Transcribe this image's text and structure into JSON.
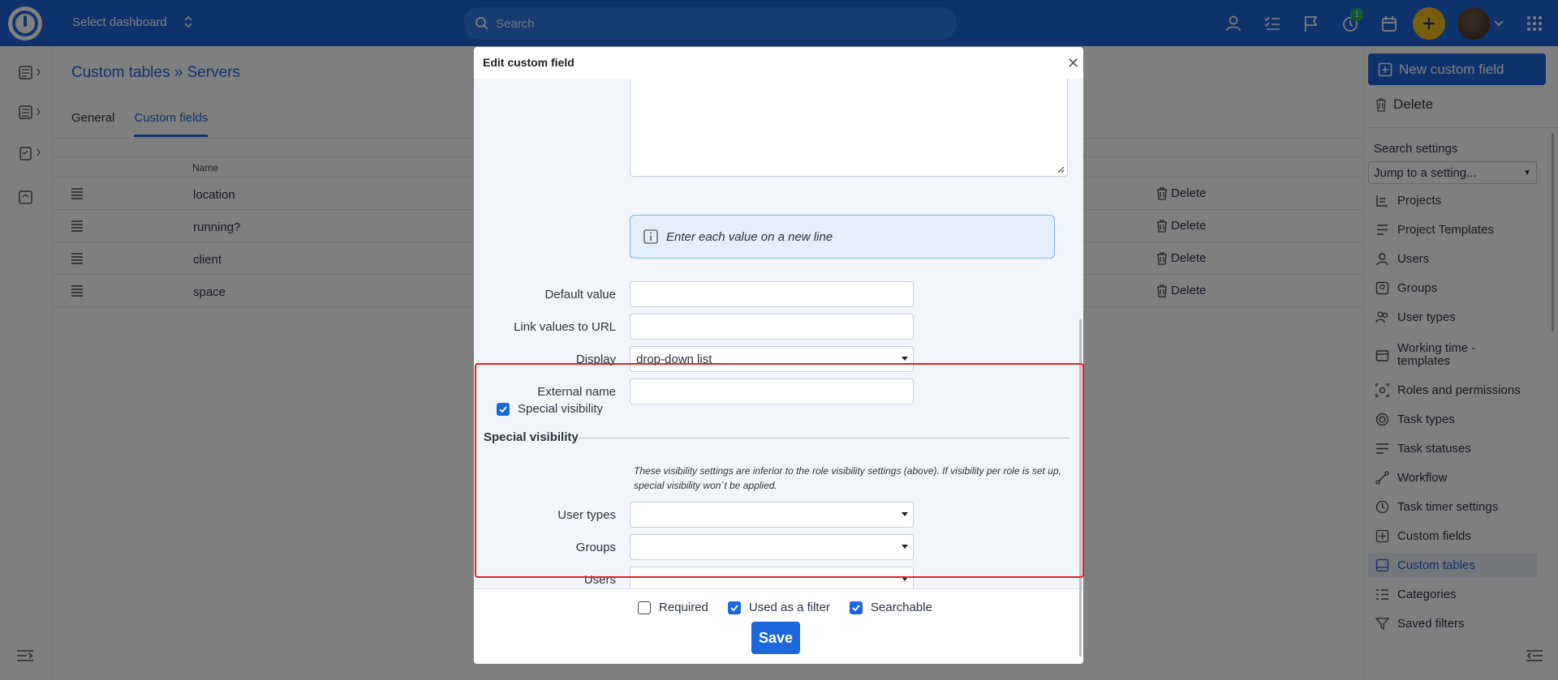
{
  "topbar": {
    "dashboard_label": "Select dashboard",
    "search_placeholder": "Search",
    "timer_badge": "1"
  },
  "page": {
    "title": "Custom tables » Servers",
    "tabs": [
      "General",
      "Custom fields"
    ],
    "active_tab": "Custom fields",
    "table_header": "Name",
    "rows": [
      {
        "name": "location",
        "action": "Delete"
      },
      {
        "name": "running?",
        "action": "Delete"
      },
      {
        "name": "client",
        "action": "Delete"
      },
      {
        "name": "space",
        "action": "Delete"
      }
    ]
  },
  "sidebar": {
    "new_button": "New custom field",
    "delete_button": "Delete",
    "search_settings_label": "Search settings",
    "jump_select": "Jump to a setting...",
    "items": [
      {
        "label": "Projects",
        "icon": "projects-icon"
      },
      {
        "label": "Project Templates",
        "icon": "templates-icon"
      },
      {
        "label": "Users",
        "icon": "user-icon"
      },
      {
        "label": "Groups",
        "icon": "groups-icon"
      },
      {
        "label": "User types",
        "icon": "user-types-icon"
      },
      {
        "label": "Working time - templates",
        "icon": "calendar-icon"
      },
      {
        "label": "Roles and permissions",
        "icon": "roles-icon"
      },
      {
        "label": "Task types",
        "icon": "target-icon"
      },
      {
        "label": "Task statuses",
        "icon": "statuses-icon"
      },
      {
        "label": "Workflow",
        "icon": "workflow-icon"
      },
      {
        "label": "Task timer settings",
        "icon": "clock-icon"
      },
      {
        "label": "Custom fields",
        "icon": "plus-square-icon"
      },
      {
        "label": "Custom tables",
        "icon": "table-icon"
      },
      {
        "label": "Categories",
        "icon": "categories-icon"
      },
      {
        "label": "Saved filters",
        "icon": "filter-icon"
      }
    ],
    "active_item": "Custom tables"
  },
  "modal": {
    "title": "Edit custom field",
    "info_hint": "Enter each value on a new line",
    "fields": {
      "default_value": {
        "label": "Default value",
        "value": ""
      },
      "link_url": {
        "label": "Link values to URL",
        "value": ""
      },
      "display": {
        "label": "Display",
        "value": "drop-down list"
      },
      "external_name": {
        "label": "External name",
        "value": ""
      }
    },
    "special_visibility_checkbox": {
      "label": "Special visibility",
      "checked": true
    },
    "special_visibility_heading": "Special visibility",
    "special_visibility_note": "These visibility settings are inferior to the role visibility settings (above). If visibility per role is set up, special visibility won´t be applied.",
    "visibility_fields": {
      "user_types": {
        "label": "User types",
        "value": ""
      },
      "groups": {
        "label": "Groups",
        "value": ""
      },
      "users": {
        "label": "Users",
        "value": ""
      }
    },
    "footer_checks": [
      {
        "label": "Required",
        "checked": false
      },
      {
        "label": "Used as a filter",
        "checked": true
      },
      {
        "label": "Searchable",
        "checked": true
      }
    ],
    "save_button": "Save"
  },
  "colors": {
    "primary": "#1c67d9",
    "accent_yellow": "#f5b81e",
    "highlight_red": "#e02424",
    "badge_green": "#26b35a"
  }
}
